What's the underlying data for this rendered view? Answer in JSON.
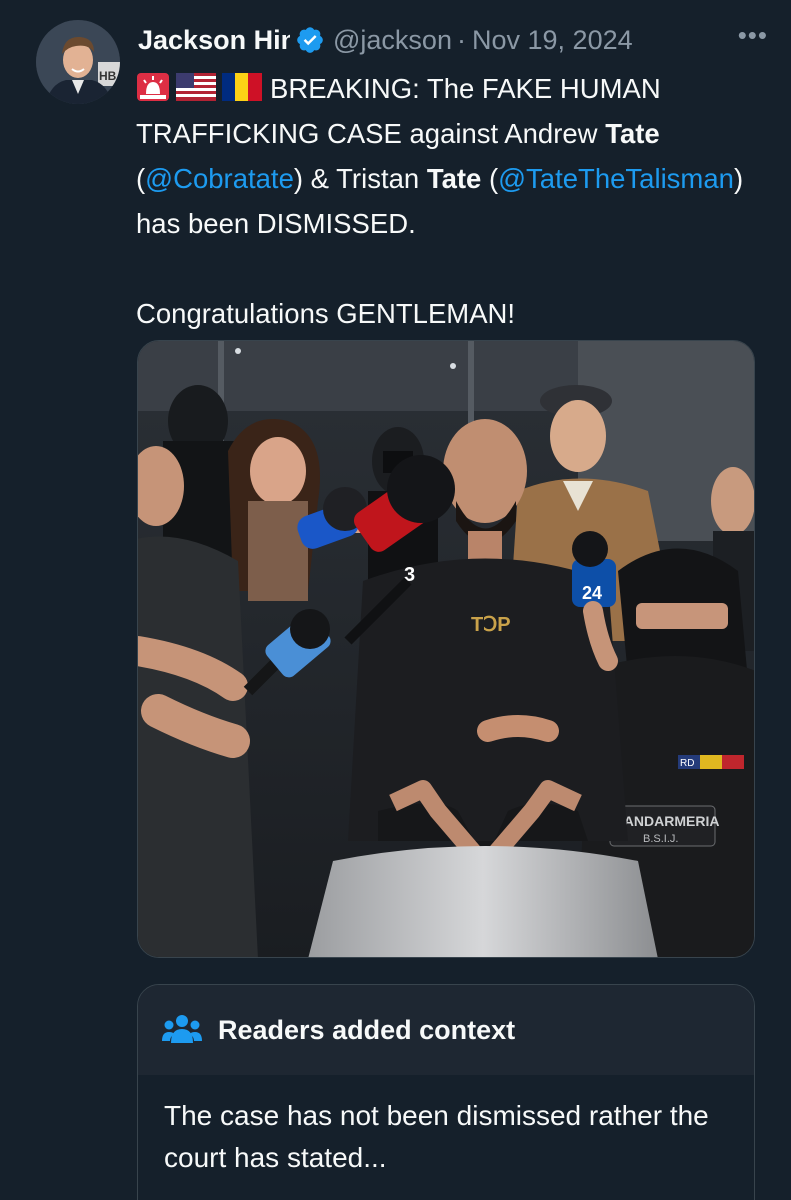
{
  "author": {
    "display_name": "Jackson Hinkl",
    "handle": "@jacksonhinkle",
    "separator": "·",
    "date": "Nov 19, 2024",
    "verified_icon": "verified-badge-icon",
    "more_icon": "more-options-icon",
    "more_label": "•••"
  },
  "post": {
    "flag_icons": [
      "rotating-light-icon",
      "us-flag-icon",
      "romania-flag-icon"
    ],
    "line1_pre": "BREAKING: The FAKE HUMAN TRAFFICKING CASE against Andrew ",
    "bold_tate_1": "Tate",
    "paren_1": " (",
    "mention_1": "@Cobratate",
    "line2_mid": ") & Tristan ",
    "bold_tate_2": "Tate",
    "paren_2": " (",
    "mention_2": "@TateTheTalisman",
    "line3_end": ") has been DISMISSED.",
    "closing": "Congratulations GENTLEMAN!"
  },
  "media": {
    "photo_texts": {
      "hoodie_logo": "TↃP",
      "mic_logo_1": "24",
      "mic_logo_2": "3",
      "patch_1": "JANDARMERIA",
      "patch_2": "B.S.I.J.",
      "patch_3": "RD"
    }
  },
  "community_note": {
    "icon": "people-group-icon",
    "title": "Readers added context",
    "text": "The case has not been dismissed rather the court has stated..."
  },
  "colors": {
    "background": "#15202b",
    "text": "#f7f9f9",
    "secondary": "#8b98a5",
    "accent": "#1d9bf0",
    "border": "#38444d"
  }
}
